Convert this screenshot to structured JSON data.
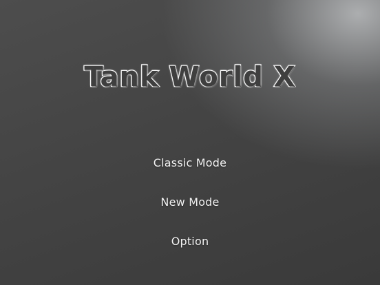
{
  "game": {
    "title": "Tank World X"
  },
  "menu": {
    "items": [
      {
        "label": "Classic Mode"
      },
      {
        "label": "New Mode"
      },
      {
        "label": "Option"
      }
    ]
  }
}
